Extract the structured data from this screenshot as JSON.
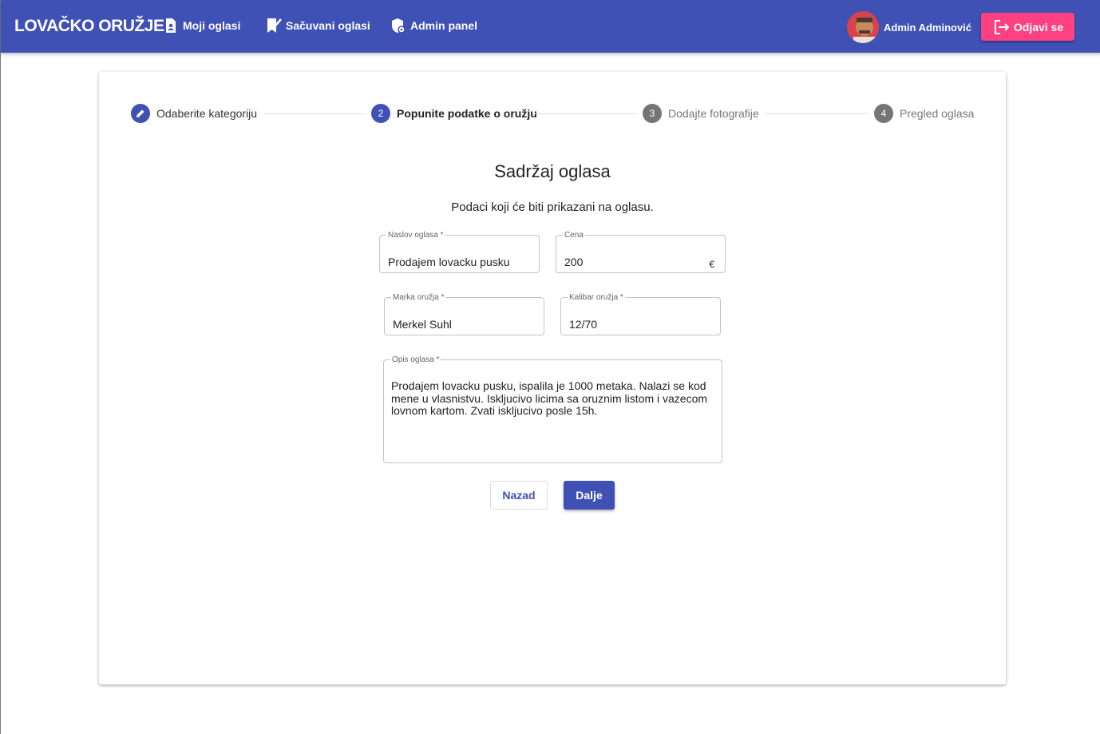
{
  "header": {
    "brand": "LOVAČKO ORUŽJE",
    "nav": [
      {
        "label": "Moji oglasi",
        "icon": "document-person-icon"
      },
      {
        "label": "Sačuvani oglasi",
        "icon": "bookmark-check-icon"
      },
      {
        "label": "Admin panel",
        "icon": "shield-gear-icon"
      }
    ],
    "user_name": "Admin Adminović",
    "logout_label": "Odjavi se",
    "colors": {
      "primary": "#3f51b5",
      "accent": "#ff4081"
    }
  },
  "stepper": {
    "steps": [
      {
        "number": "",
        "label": "Odaberite kategoriju",
        "state": "done",
        "icon": "pencil-icon"
      },
      {
        "number": "2",
        "label": "Popunite podatke o oružju",
        "state": "active"
      },
      {
        "number": "3",
        "label": "Dodajte fotografije",
        "state": "inactive"
      },
      {
        "number": "4",
        "label": "Pregled oglasa",
        "state": "inactive"
      }
    ]
  },
  "form": {
    "heading": "Sadržaj oglasa",
    "subheading": "Podaci koji će biti prikazani na oglasu.",
    "title": {
      "label": "Naslov oglasa *",
      "value": "Prodajem lovacku pusku"
    },
    "price": {
      "label": "Cena",
      "value": "200",
      "suffix": "€"
    },
    "brand": {
      "label": "Marka oružja *",
      "value": "Merkel Suhl"
    },
    "caliber": {
      "label": "Kalibar oružja *",
      "value": "12/70"
    },
    "description": {
      "label": "Opis oglasa *",
      "value": "Prodajem lovacku pusku, ispalila je 1000 metaka. Nalazi se kod mene u vlasnistvu. Iskljucivo licima sa oruznim listom i vazecom lovnom kartom. Zvati iskljucivo posle 15h."
    },
    "back_label": "Nazad",
    "next_label": "Dalje"
  }
}
